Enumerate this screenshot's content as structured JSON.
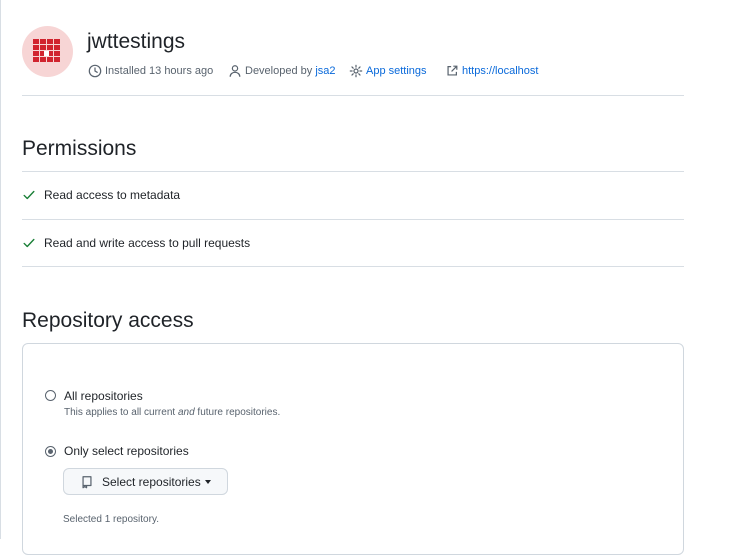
{
  "app": {
    "name": "jwttestings",
    "installed": "Installed 13 hours ago",
    "developed_prefix": "Developed by",
    "developer": "jsa2",
    "settings_link": "App settings",
    "homepage_link": "https://localhost"
  },
  "permissions": {
    "title": "Permissions",
    "items": [
      {
        "strong1": "Read",
        "middle": "",
        "strong2": "",
        "rest": " access to metadata"
      },
      {
        "strong1": "Read",
        "middle": " and ",
        "strong2": "write",
        "rest": " access to pull requests"
      }
    ]
  },
  "repo_access": {
    "title": "Repository access",
    "all_label": "All repositories",
    "all_note_prefix": "This applies to all current ",
    "all_note_em": "and",
    "all_note_suffix": " future repositories.",
    "only_label": "Only select repositories",
    "select_button": "Select repositories",
    "selected_text": "Selected 1 repository.",
    "selected_option": "only_select"
  },
  "colors": {
    "accent": "#0969da",
    "check": "#1a7f37",
    "avatar_bg": "#f7d5d5",
    "avatar_mark": "#d1242f"
  }
}
